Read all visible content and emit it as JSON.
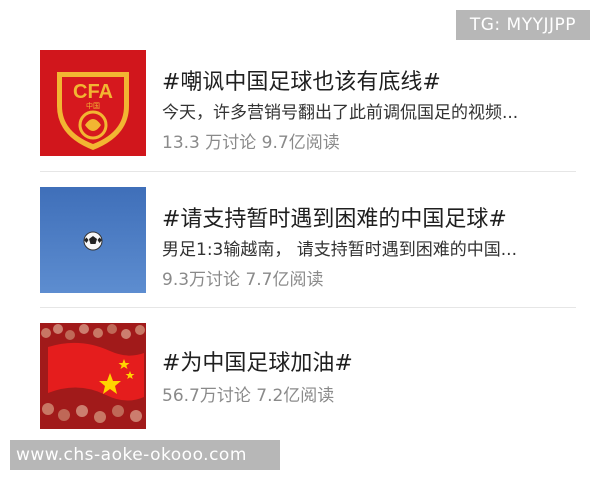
{
  "watermark_top": "TG: MYYJJPP",
  "watermark_bottom": "www.chs-aoke-okooo.com",
  "items": [
    {
      "title": "#嘲讽中国足球也该有底线#",
      "summary": "今天，许多营销号翻出了此前调侃国足的视频...",
      "stats": "13.3 万讨论 9.7亿阅读",
      "thumbnail_text": "CFA",
      "thumbnail_subtext": "中国"
    },
    {
      "title": "#请支持暂时遇到困难的中国足球#",
      "summary": "男足1:3输越南， 请支持暂时遇到困难的中国...",
      "stats": "9.3万讨论 7.7亿阅读"
    },
    {
      "title": "#为中国足球加油#",
      "stats": "56.7万讨论 7.2亿阅读"
    }
  ],
  "colors": {
    "title": "#1f1f1f",
    "summary": "#333333",
    "stats": "#8a8a8a",
    "divider": "#e6e6e6",
    "watermark_bg": "#b7b7b7",
    "cfa_red": "#d6181e",
    "cfa_gold": "#f2b632",
    "sky_blue": "#4f7cc0"
  }
}
